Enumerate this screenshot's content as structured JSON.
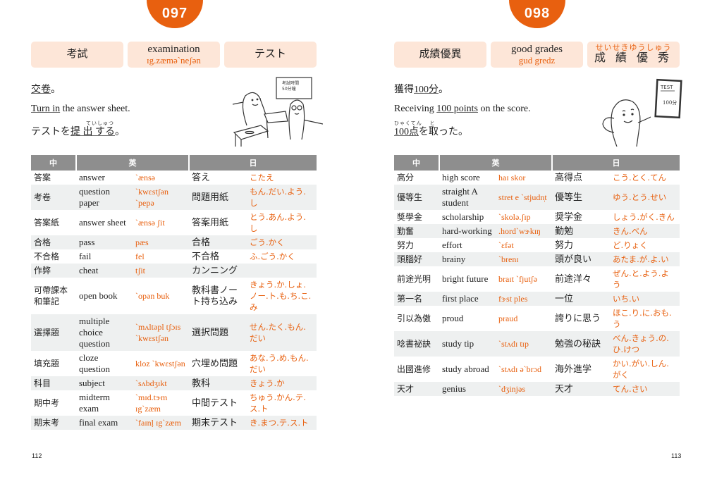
{
  "pages": [
    {
      "number": "097",
      "page_number": "112",
      "header": {
        "zh": "考試",
        "en": "examination",
        "en_ipa": "ɪg.zæmə`neʃən",
        "ja_ruby": "",
        "ja": "テスト"
      },
      "examples": {
        "zh_pre": "",
        "zh_underlined": "交卷",
        "zh_post": "。",
        "en_underlined": "Turn in",
        "en_post": " the answer sheet.",
        "ja_ruby": "ていしゅつ",
        "ja_pre": "テストを",
        "ja_underlined": "提 出 する",
        "ja_post": "。"
      },
      "illustration": {
        "icon": "two-characters-handing-paper-illustration",
        "board_text": "考試時間 50分鐘"
      },
      "table": {
        "headers": [
          "中",
          "英",
          "日"
        ],
        "rows": [
          {
            "zh": "答案",
            "en": "answer",
            "ipa": "`ænsə",
            "ja": "答え",
            "kana": "こたえ"
          },
          {
            "zh": "考卷",
            "en": "question paper",
            "ipa": "`kwɛstʃən `pepə",
            "ja": "問題用紙",
            "kana": "もん.だい.よう.し"
          },
          {
            "zh": "答案紙",
            "en": "answer sheet",
            "ipa": "`ænsə ʃit",
            "ja": "答案用紙",
            "kana": "とう.あん.よう.し"
          },
          {
            "zh": "合格",
            "en": "pass",
            "ipa": "pæs",
            "ja": "合格",
            "kana": "ごう.かく"
          },
          {
            "zh": "不合格",
            "en": "fail",
            "ipa": "fel",
            "ja": "不合格",
            "kana": "ふ.ごう.かく"
          },
          {
            "zh": "作弊",
            "en": "cheat",
            "ipa": "tʃit",
            "ja": "カンニング",
            "kana": ""
          },
          {
            "zh": "可帶課本和筆記",
            "en": "open book",
            "ipa": "`opən buk",
            "ja": "教科書ノート持ち込み",
            "kana": "きょう.か.しょ.ノー.ト.も.ち.こ.み"
          },
          {
            "zh": "選擇題",
            "en": "multiple choice question",
            "ipa": "`mʌltəpl tʃɔɪs `kwɛstʃən",
            "ja": "選択問題",
            "kana": "せん.たく.もん.だい"
          },
          {
            "zh": "填充題",
            "en": "cloze question",
            "ipa": "kloz `kwɛstʃən",
            "ja": "穴埋め問題",
            "kana": "あな.う.め.もん.だい"
          },
          {
            "zh": "科目",
            "en": "subject",
            "ipa": "`sʌbdʒɪkt",
            "ja": "教科",
            "kana": "きょう.か"
          },
          {
            "zh": "期中考",
            "en": "midterm exam",
            "ipa": "`mɪd.tɝm ɪg`zæm",
            "ja": "中間テスト",
            "kana": "ちゅう.かん.テ.ス.ト"
          },
          {
            "zh": "期末考",
            "en": "final exam",
            "ipa": "`faɪnḷ ɪg`zæm",
            "ja": "期末テスト",
            "kana": "き.まつ.テ.ス.ト"
          }
        ]
      }
    },
    {
      "number": "098",
      "page_number": "113",
      "header": {
        "zh": "成績優異",
        "en": "good grades",
        "en_ipa": "gud gredz",
        "ja_ruby": "せいせきゆうしゅう",
        "ja": "成 績 優 秀"
      },
      "examples": {
        "zh_pre": "獲得",
        "zh_underlined": "100分",
        "zh_post": "。",
        "en_pre": "Receiving ",
        "en_underlined": "100 points",
        "en_post": " on the score.",
        "ja_ruby": "ひゃくてん　 と",
        "ja_pre": "",
        "ja_underlined": "100点",
        "ja_post": "を取った。"
      },
      "illustration": {
        "icon": "character-holding-test-paper-illustration",
        "paper_title": "TEST",
        "paper_score": "100分"
      },
      "table": {
        "headers": [
          "中",
          "英",
          "日"
        ],
        "rows": [
          {
            "zh": "高分",
            "en": "high score",
            "ipa": "haɪ skor",
            "ja": "高得点",
            "kana": "こう.とく.てん"
          },
          {
            "zh": "優等生",
            "en": "straight A student",
            "ipa": "stret e `stjudn̩t",
            "ja": "優等生",
            "kana": "ゆう.とう.せい"
          },
          {
            "zh": "獎學金",
            "en": "scholarship",
            "ipa": "`skolə.ʃɪp",
            "ja": "奨学金",
            "kana": "しょう.がく.きん"
          },
          {
            "zh": "勤奮",
            "en": "hard-working",
            "ipa": ".hord`wɝkɪŋ",
            "ja": "勤勉",
            "kana": "きん.べん"
          },
          {
            "zh": "努力",
            "en": "effort",
            "ipa": "`ɛfət",
            "ja": "努力",
            "kana": "ど.りょく"
          },
          {
            "zh": "頭腦好",
            "en": "brainy",
            "ipa": "`brenɪ",
            "ja": "頭が良い",
            "kana": "あたま.が.よ.い"
          },
          {
            "zh": "前途光明",
            "en": "bright future",
            "ipa": "braɪt `fjutʃə",
            "ja": "前途洋々",
            "kana": "ぜん.と.よう.よう"
          },
          {
            "zh": "第一名",
            "en": "first place",
            "ipa": "fɝst ples",
            "ja": "一位",
            "kana": "いち.い"
          },
          {
            "zh": "引以為傲",
            "en": "proud",
            "ipa": "praud",
            "ja": "誇りに思う",
            "kana": "ほこ.り.に.おも.う"
          },
          {
            "zh": "唸書祕訣",
            "en": "study tip",
            "ipa": "`stʌdɪ tɪp",
            "ja": "勉強の秘訣",
            "kana": "べん.きょう.の.ひ.けつ"
          },
          {
            "zh": "出國進修",
            "en": "study abroad",
            "ipa": "`stʌdɪ ə`brɔd",
            "ja": "海外進学",
            "kana": "かい.がい.しん.がく"
          },
          {
            "zh": "天才",
            "en": "genius",
            "ipa": "`dʒinjəs",
            "ja": "天才",
            "kana": "てん.さい"
          }
        ]
      }
    }
  ]
}
